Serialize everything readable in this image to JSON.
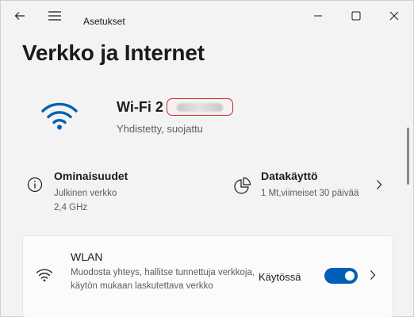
{
  "window": {
    "app_title": "Asetukset"
  },
  "page": {
    "title": "Verkko ja Internet"
  },
  "network": {
    "name": "Wi-Fi 2",
    "status": "Yhdistetty, suojattu"
  },
  "properties": {
    "title": "Ominaisuudet",
    "line1": "Julkinen verkko",
    "line2": "2,4 GHz"
  },
  "data_usage": {
    "title": "Datakäyttö",
    "line1": "1 Mt,viimeiset 30 päivää"
  },
  "wlan": {
    "title": "WLAN",
    "description": "Muodosta yhteys, hallitse tunnettuja verkkoja, käytön mukaan laskutettava verkko",
    "state_label": "Käytössä",
    "enabled": true
  },
  "colors": {
    "accent": "#005fb8",
    "highlight_border": "#d2232a"
  },
  "icons": {
    "back": "back-arrow-icon",
    "menu": "hamburger-menu-icon",
    "minimize": "minimize-icon",
    "maximize": "maximize-icon",
    "close": "close-icon",
    "wifi": "wifi-icon",
    "info": "info-icon",
    "data": "pie-chart-icon",
    "chevron": "chevron-right-icon"
  }
}
